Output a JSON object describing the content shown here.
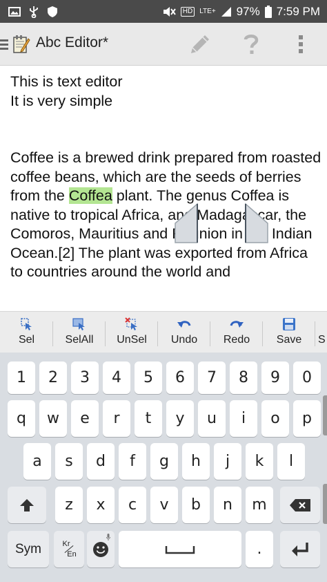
{
  "status_bar": {
    "battery": "97%",
    "time": "7:59 PM",
    "network": "HD",
    "lte": "LTE+"
  },
  "action_bar": {
    "title": "Abc Editor*",
    "icons": [
      "menu-icon",
      "notepad-icon",
      "pencil-icon",
      "help-icon",
      "overflow-icon"
    ]
  },
  "editor": {
    "line1": "This is text editor",
    "line2": "It is very simple",
    "para_before": "Coffee is a brewed drink prepared from roasted coffee beans, which are the seeds of berries from the ",
    "selected": "Coffea",
    "para_after": " plant. The genus Coffea is native to tropical Africa, and Madagascar, the Comoros, Mauritius and Réunion in the Indian Ocean.[2] The plant was exported from Africa to countries around the world and",
    "highlight_color": "#b3e592"
  },
  "toolbar": {
    "buttons": [
      {
        "label": "Sel",
        "icon": "select-icon"
      },
      {
        "label": "SelAll",
        "icon": "select-all-icon"
      },
      {
        "label": "UnSel",
        "icon": "unselect-icon"
      },
      {
        "label": "Undo",
        "icon": "undo-icon"
      },
      {
        "label": "Redo",
        "icon": "redo-icon"
      },
      {
        "label": "Save",
        "icon": "save-icon"
      },
      {
        "label": "S",
        "icon": "more-icon"
      }
    ]
  },
  "keyboard": {
    "row_numbers": [
      "1",
      "2",
      "3",
      "4",
      "5",
      "6",
      "7",
      "8",
      "9",
      "0"
    ],
    "row_top": [
      "q",
      "w",
      "e",
      "r",
      "t",
      "y",
      "u",
      "i",
      "o",
      "p"
    ],
    "row_home": [
      "a",
      "s",
      "d",
      "f",
      "g",
      "h",
      "j",
      "k",
      "l"
    ],
    "row_bottom": [
      "z",
      "x",
      "c",
      "v",
      "b",
      "n",
      "m"
    ],
    "sym": "Sym",
    "lang_top": "Kr",
    "lang_bottom": "En",
    "period": ".",
    "shift_icon": "shift-icon",
    "backspace_icon": "backspace-icon",
    "enter_icon": "enter-icon",
    "space_icon": "space-icon",
    "emoji_icon": "emoji-icon"
  }
}
